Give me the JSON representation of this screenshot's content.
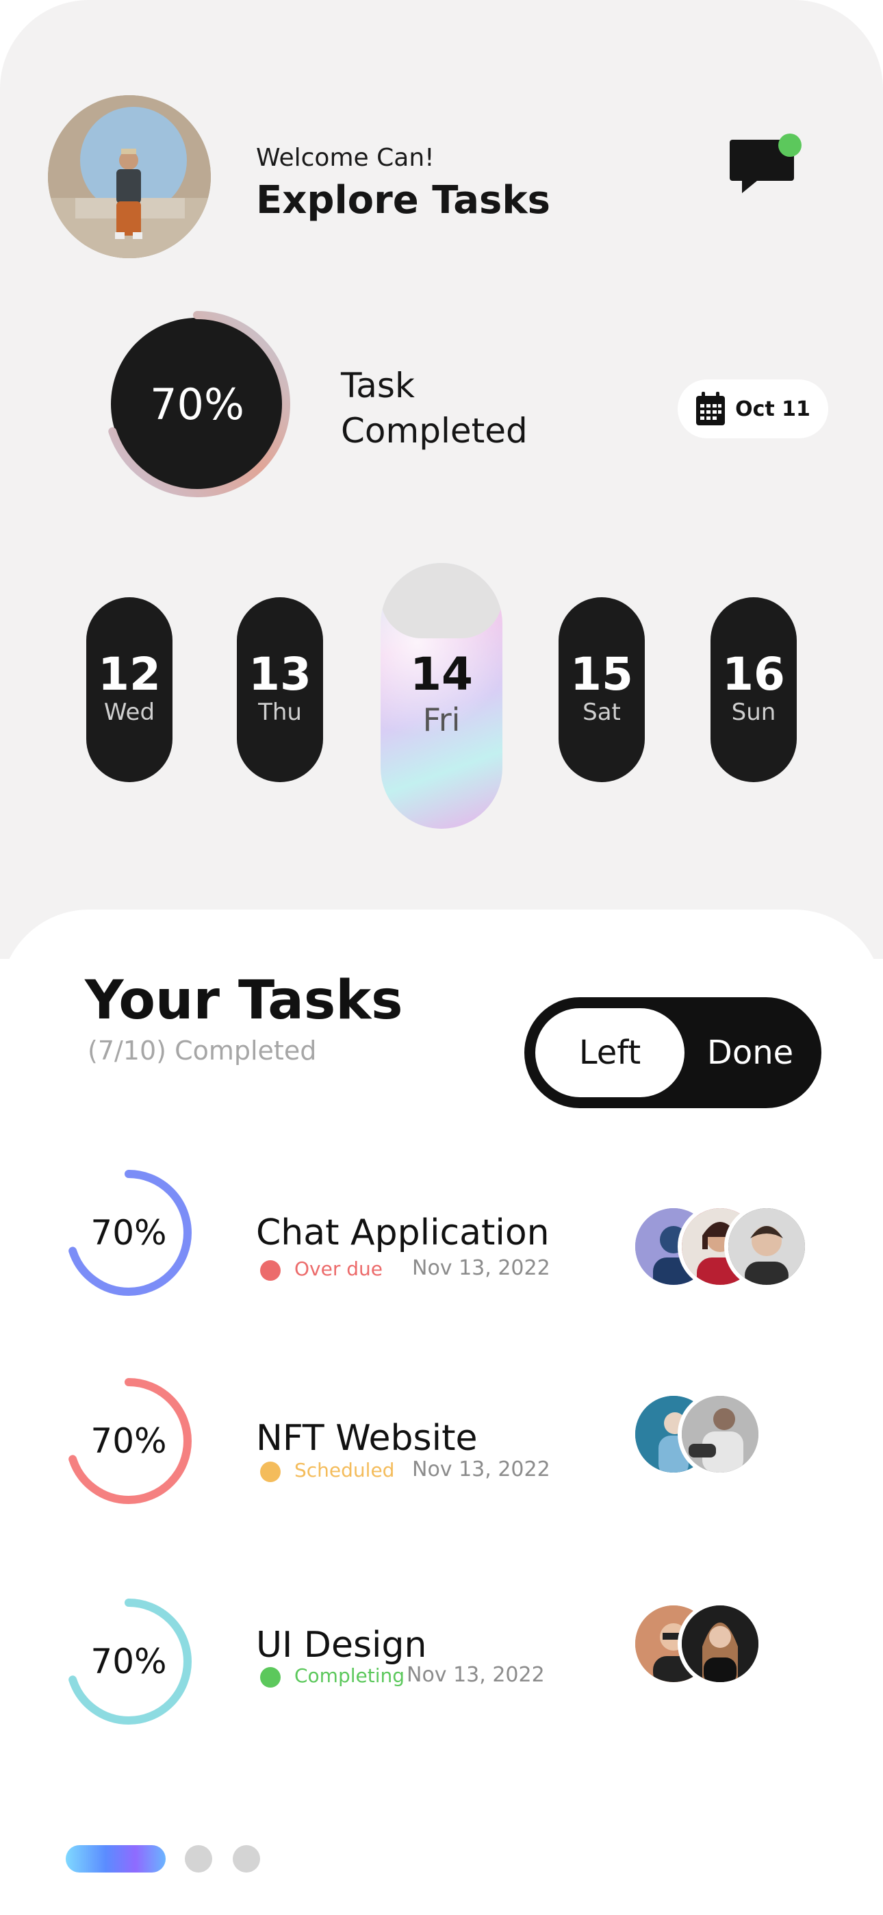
{
  "header": {
    "welcome": "Welcome Can!",
    "title": "Explore Tasks",
    "icon": "chat-icon",
    "notification_color": "#5cc85c"
  },
  "summary": {
    "percent_label": "70%",
    "progress": 0.7,
    "label": "Task Completed",
    "date_label": "Oct 11",
    "date_icon": "calendar-icon"
  },
  "days": [
    {
      "num": "12",
      "name": "Wed"
    },
    {
      "num": "13",
      "name": "Thu"
    },
    {
      "num": "14",
      "name": "Fri",
      "selected": true
    },
    {
      "num": "15",
      "name": "Sat"
    },
    {
      "num": "16",
      "name": "Sun"
    }
  ],
  "tasks_section": {
    "title": "Your Tasks",
    "subtitle": "(7/10) Completed",
    "toggle": {
      "left": "Left",
      "right": "Done"
    }
  },
  "tasks": [
    {
      "name": "Chat Application",
      "percent": "70%",
      "progress": 0.7,
      "ring_color": "#7b8df7",
      "status": "Over due",
      "status_color": "#ec6b6b",
      "date": "Nov 13, 2022",
      "member_count": 3
    },
    {
      "name": "NFT Website",
      "percent": "70%",
      "progress": 0.7,
      "ring_color": "#f58080",
      "status": "Scheduled",
      "status_color": "#f4bc5b",
      "date": "Nov 13, 2022",
      "member_count": 2
    },
    {
      "name": "UI Design",
      "percent": "70%",
      "progress": 0.7,
      "ring_color": "#8ddbe1",
      "status": "Completing",
      "status_color": "#5cc85c",
      "date": "Nov 13, 2022",
      "member_count": 2
    }
  ],
  "pager": {
    "pages": 3,
    "active": 1
  }
}
